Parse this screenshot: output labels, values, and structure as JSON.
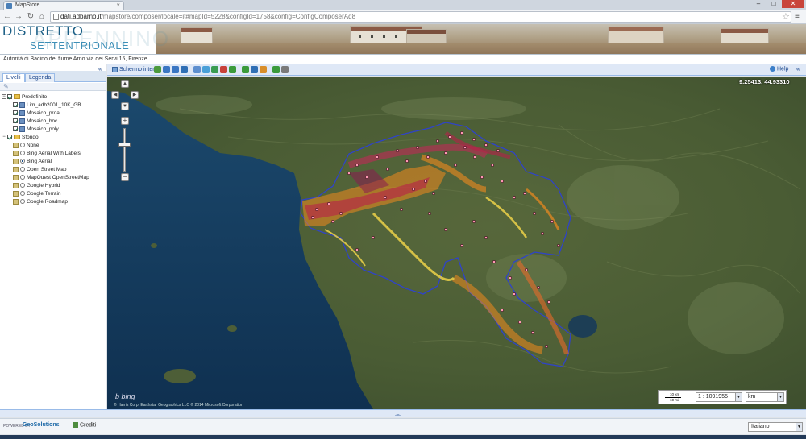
{
  "browser": {
    "tab_title": "MapStore",
    "tab_close": "×",
    "url_host": "dati.adbarno.it",
    "url_path": "/mapstore/composer/locale=it#mapId=5228&configId=1758&config=ConfigComposerAd8",
    "back": "←",
    "forward": "→",
    "reload": "↻",
    "home": "⌂",
    "minimize": "–",
    "maximize": "□",
    "close": "✕",
    "bookmark": "☆",
    "menu": "≡"
  },
  "banner": {
    "title_line1": "DISTRETTO",
    "title_line2": "SETTENTRIONALE",
    "watermark": "APPENNINO"
  },
  "subheader": {
    "text": "Autorità di Bacino del fiume Arno     via dei Servi 15, Firenze"
  },
  "left_panel": {
    "collapse": "«",
    "tabs": [
      "Livelli",
      "Legenda"
    ],
    "active_tab": 0,
    "tree": [
      {
        "label": "Predefinito",
        "kind": "folder",
        "level": 0,
        "checked": true
      },
      {
        "label": "Lim_adb2001_10K_GB",
        "kind": "layer",
        "level": 1,
        "checked": true
      },
      {
        "label": "Mosaico_proal",
        "kind": "layer",
        "level": 1,
        "checked": true
      },
      {
        "label": "Mosaico_bnc",
        "kind": "layer",
        "level": 1,
        "checked": true
      },
      {
        "label": "Mosaico_poly",
        "kind": "layer",
        "level": 1,
        "checked": true
      },
      {
        "label": "Sfondo",
        "kind": "folder",
        "level": 0,
        "checked": true
      },
      {
        "label": "None",
        "kind": "base",
        "level": 1,
        "selected": false
      },
      {
        "label": "Bing Aerial With Labels",
        "kind": "base",
        "level": 1,
        "selected": false
      },
      {
        "label": "Bing Aerial",
        "kind": "base",
        "level": 1,
        "selected": true
      },
      {
        "label": "Open Street Map",
        "kind": "base",
        "level": 1,
        "selected": false
      },
      {
        "label": "MapQuest OpenStreetMap",
        "kind": "base",
        "level": 1,
        "selected": false
      },
      {
        "label": "Google Hybrid",
        "kind": "base",
        "level": 1,
        "selected": false
      },
      {
        "label": "Google Terrain",
        "kind": "base",
        "level": 1,
        "selected": false
      },
      {
        "label": "Google Roadmap",
        "kind": "base",
        "level": 1,
        "selected": false
      }
    ]
  },
  "map_toolbar": {
    "full_screen_label": "Schermo intero",
    "help_label": "Help",
    "collapse_right": "«",
    "tool_colors": [
      "#4c9a3c",
      "#3a76c3",
      "#3a76c3",
      "#2f6fb5",
      "#5d8fcf",
      "#4aa0d8",
      "#3a9d52",
      "#c8413a",
      "#3b9b3b",
      "#3b9b3b",
      "#2f6fb5",
      "#d98e2a",
      "#3b9b3b",
      "#7a7a7a"
    ]
  },
  "map": {
    "coordinates": "9.25413, 44.93310",
    "pan_up": "▲",
    "pan_down": "▼",
    "pan_left": "◀",
    "pan_right": "▶",
    "zoom_in": "+",
    "zoom_out": "−",
    "bing_logo": "b bing",
    "attribution": "© Harris Corp, Earthstar Geographics LLC © 2014 Microsoft Corporation",
    "scale_top": "10 km",
    "scale_bottom": "10 mi",
    "scale_value": "1 : 1091955",
    "units": "km"
  },
  "footer": {
    "collapse": "︽",
    "powered_by": "POWERED BY",
    "geosolutions": "GeoSolutions",
    "credits": "Crediti",
    "language": "Italiano"
  },
  "colors": {
    "accent": "#15428b",
    "panel_border": "#99bbe8",
    "basin_outline": "#2f43c9",
    "hazard_high": "#b8204a",
    "hazard_mid": "#f08a1e",
    "hazard_low": "#f6d84a"
  }
}
